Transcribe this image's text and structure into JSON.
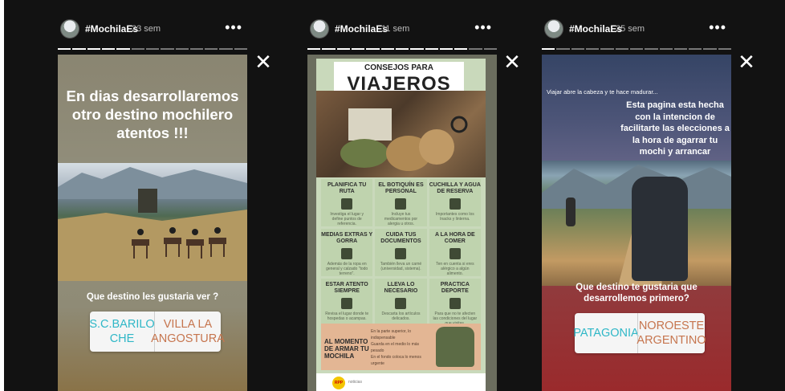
{
  "stories": [
    {
      "username": "#MochilaEs",
      "time": "23 sem",
      "more": "•••",
      "close": "✕",
      "headline": "En dias desarrollaremos otro destino mochilero atentos !!!",
      "question": "Que destino les gustaria ver ?",
      "poll": [
        "S.C.BARILO CHE",
        "VILLA LA ANGOSTURA"
      ]
    },
    {
      "username": "#MochilaEs",
      "time": "11 sem",
      "more": "•••",
      "close": "✕",
      "infographic": {
        "title_top": "CONSEJOS PARA",
        "title_main": "VIAJEROS",
        "tips": [
          {
            "title": "PLANIFICA TU RUTA",
            "desc": "Investiga el lugar y define puntos de referencia."
          },
          {
            "title": "EL BOTIQUÍN ES PERSONAL",
            "desc": "Incluye tus medicamentos por alergia u otros."
          },
          {
            "title": "CUCHILLA Y AGUA DE RESERVA",
            "desc": "Importantes como los lnacks y linterna."
          },
          {
            "title": "MEDIAS EXTRAS Y GORRA",
            "desc": "Además de la ropa en general y calzado \"todo terreno\"."
          },
          {
            "title": "CUIDA TUS DOCUMENTOS",
            "desc": "También lleva un carné (universidad, sistema)."
          },
          {
            "title": "A LA HORA DE COMER",
            "desc": "Ten en cuenta si eres alérgico a algún alimento."
          },
          {
            "title": "ESTAR ATENTO SIEMPRE",
            "desc": "Revisa el lugar donde te hospedas o acampas."
          },
          {
            "title": "LLEVA LO NECESARIO",
            "desc": "Descarta los artículos delicados."
          },
          {
            "title": "PRACTICA DEPORTE",
            "desc": "Para que no te afecten las condiciones del lugar que visitas."
          }
        ],
        "pack_title": "AL MOMENTO DE ARMAR TU MOCHILA",
        "pack_lines": [
          "En la parte superior, lo indispensable",
          "Guarda en el medio lo más pesado",
          "En el fondo coloca lo menos urgente"
        ],
        "footer_logo": "RPP",
        "footer_text": "noticias"
      }
    },
    {
      "username": "#MochilaEs",
      "time": "25 sem",
      "more": "•••",
      "close": "✕",
      "small_text": "Viajar abre la cabeza y te hace madurar...",
      "description": "Esta pagina esta hecha con la intencion de facilitarte las elecciones a la hora de agarrar tu mochi y arrancar",
      "question": "Que destino te gustaria que desarrollemos primero?",
      "poll": [
        "PATAGONIA",
        "NOROESTE ARGENTINO"
      ]
    }
  ],
  "colors": {
    "optionA": "#2fb7c7",
    "optionB": "#c6754e",
    "background": "#121212"
  }
}
